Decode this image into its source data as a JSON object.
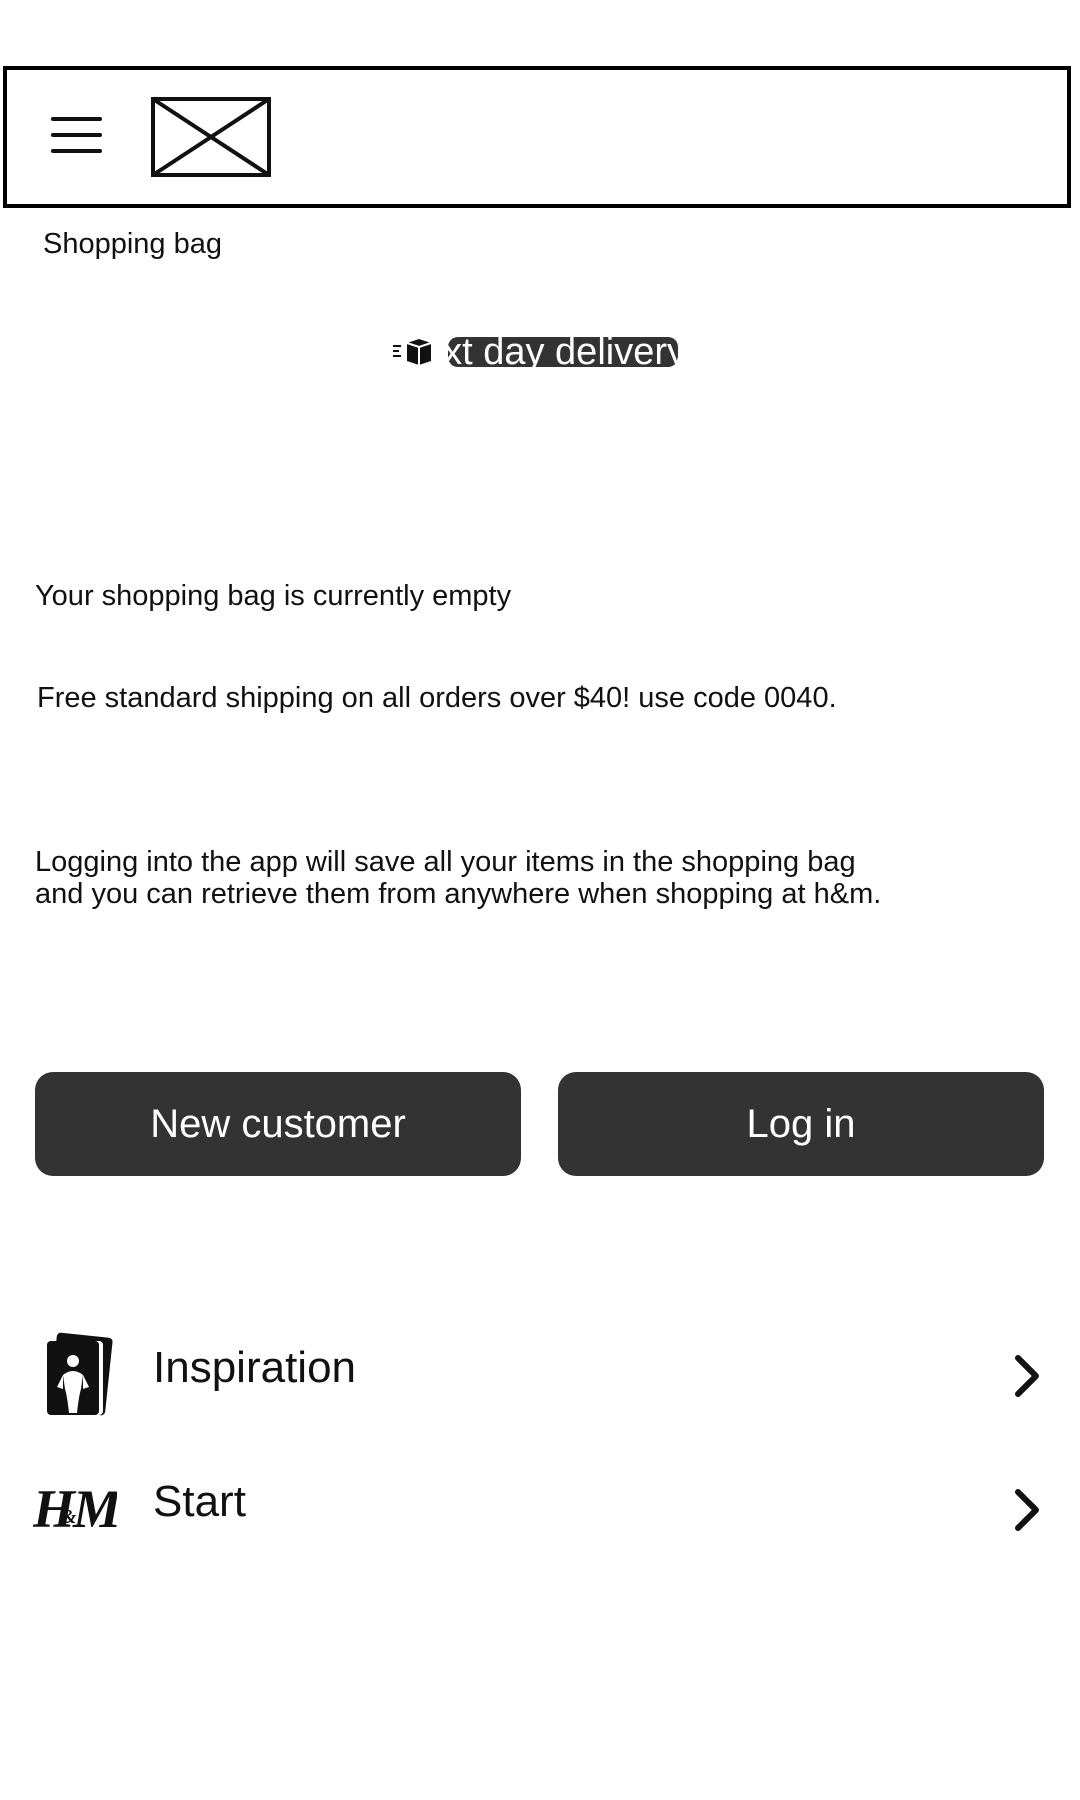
{
  "header": {
    "menu_icon": "hamburger-menu-icon",
    "logo_icon": "image-placeholder-icon"
  },
  "page": {
    "title": "Shopping bag"
  },
  "delivery_banner": {
    "icon": "delivery-box-icon",
    "text": "Next day delivery"
  },
  "messages": {
    "empty": "Your shopping bag is currently empty",
    "shipping": "Free standard shipping on all orders over $40! use code 0040.",
    "login_info_line1": "Logging into the app will save all your items in the shopping bag",
    "login_info_line2": "and you can retrieve them from anywhere when shopping at h&m."
  },
  "buttons": {
    "new_customer": "New customer",
    "log_in": "Log in"
  },
  "nav": [
    {
      "label": "Inspiration",
      "icon": "inspiration-photo-icon"
    },
    {
      "label": "Start",
      "icon": "hm-logo-icon"
    }
  ],
  "colors": {
    "button_bg": "#333333",
    "button_text": "#ffffff",
    "text": "#111111",
    "border": "#000000"
  }
}
